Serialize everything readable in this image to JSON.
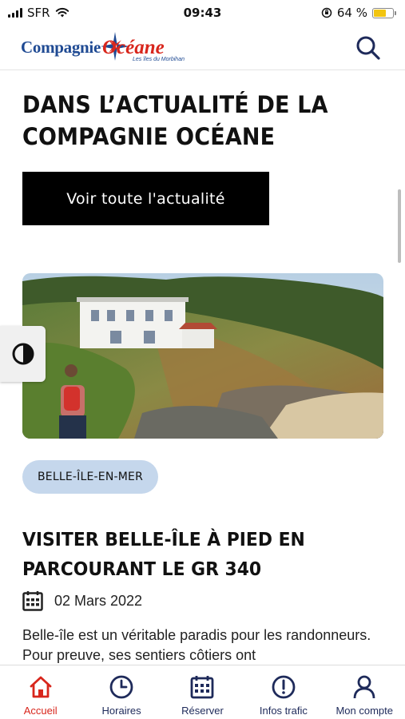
{
  "status_bar": {
    "carrier": "SFR",
    "time": "09:43",
    "battery": "64 %",
    "battery_level": 0.64,
    "battery_color": "#f2c511"
  },
  "header": {
    "logo_word1": "Compagnie",
    "logo_word2": "Océane",
    "logo_tagline": "Les îles du Morbihan",
    "search_icon": "search-icon",
    "brand_blue": "#1f4a93",
    "brand_red": "#d8261c"
  },
  "news": {
    "section_title": "DANS L’ACTUALITÉ DE LA COMPAGNIE OCÉANE",
    "cta_label": "Voir toute l'actualité",
    "contrast_icon": "contrast-icon"
  },
  "article": {
    "tag": "BELLE-ÎLE-EN-MER",
    "title": "VISITER BELLE-ÎLE À PIED EN PARCOURANT LE GR 340",
    "date": "02 Mars 2022",
    "excerpt": "Belle-île est un véritable paradis pour les randonneurs. Pour preuve, ses sentiers côtiers ont",
    "tag_color": "#c5d7ec"
  },
  "bottom_nav": {
    "items": [
      {
        "label": "Accueil",
        "icon": "home-icon",
        "active": true
      },
      {
        "label": "Horaires",
        "icon": "clock-icon",
        "active": false
      },
      {
        "label": "Réserver",
        "icon": "calendar-icon",
        "active": false
      },
      {
        "label": "Infos trafic",
        "icon": "alert-icon",
        "active": false
      },
      {
        "label": "Mon compte",
        "icon": "user-icon",
        "active": false
      }
    ],
    "active_color": "#d8261c",
    "inactive_color": "#1e2a5a"
  }
}
